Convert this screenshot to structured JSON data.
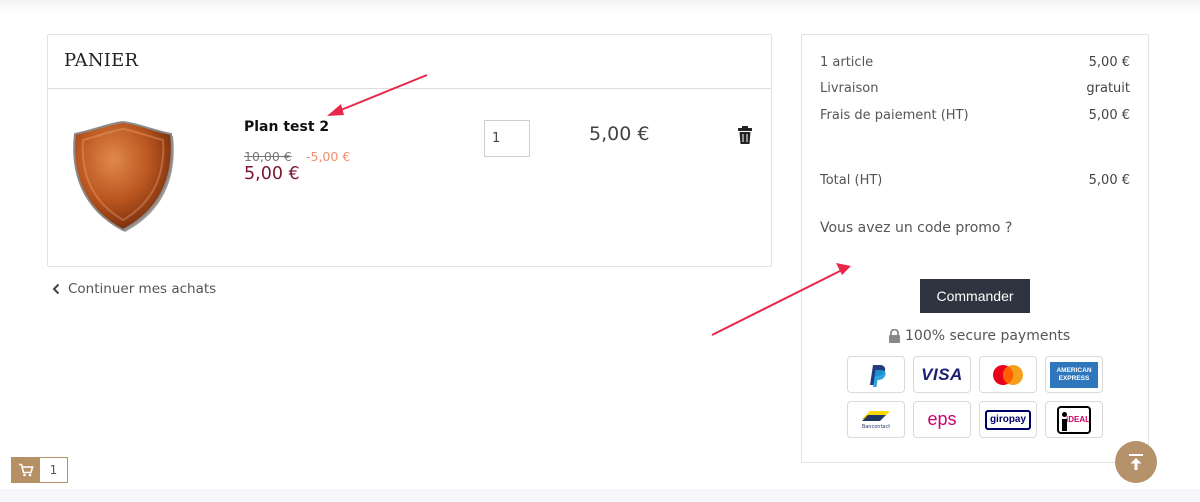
{
  "cart": {
    "title": "PANIER",
    "item": {
      "name": "Plan test 2",
      "old_price": "10,00 €",
      "discount": "-5,00 €",
      "new_price": "5,00 €",
      "quantity": "1",
      "line_total": "5,00 €",
      "image_icon": "shield-icon"
    },
    "continue_label": "Continuer mes achats"
  },
  "summary": {
    "rows": [
      {
        "label": "1 article",
        "value": "5,00 €"
      },
      {
        "label": "Livraison",
        "value": "gratuit"
      },
      {
        "label": "Frais de paiement (HT)",
        "value": "5,00 €"
      },
      {
        "label": "Total (HT)",
        "value": "5,00 €"
      }
    ],
    "promo_label": "Vous avez un code promo ?",
    "order_button": "Commander",
    "secure_label": "100% secure payments",
    "payment_methods": [
      {
        "name": "PayPal",
        "icon": "paypal-icon",
        "text": ""
      },
      {
        "name": "Visa",
        "icon": "visa-icon",
        "text": "VISA"
      },
      {
        "name": "Mastercard",
        "icon": "mastercard-icon",
        "text": ""
      },
      {
        "name": "American Express",
        "icon": "amex-icon",
        "text": "AMERICAN EXPRESS"
      },
      {
        "name": "Bancontact",
        "icon": "bancontact-icon",
        "text": "Bancontact"
      },
      {
        "name": "EPS",
        "icon": "eps-icon",
        "text": "eps"
      },
      {
        "name": "Giropay",
        "icon": "giropay-icon",
        "text": "giropay"
      },
      {
        "name": "iDEAL",
        "icon": "ideal-icon",
        "text": "iDEAL"
      }
    ]
  },
  "mini_cart": {
    "count": "1"
  },
  "colors": {
    "accent": "#b5926a",
    "button": "#2e3440",
    "price": "#7a1630",
    "discount": "#f0906a",
    "annotation_arrow": "#e8274a"
  }
}
